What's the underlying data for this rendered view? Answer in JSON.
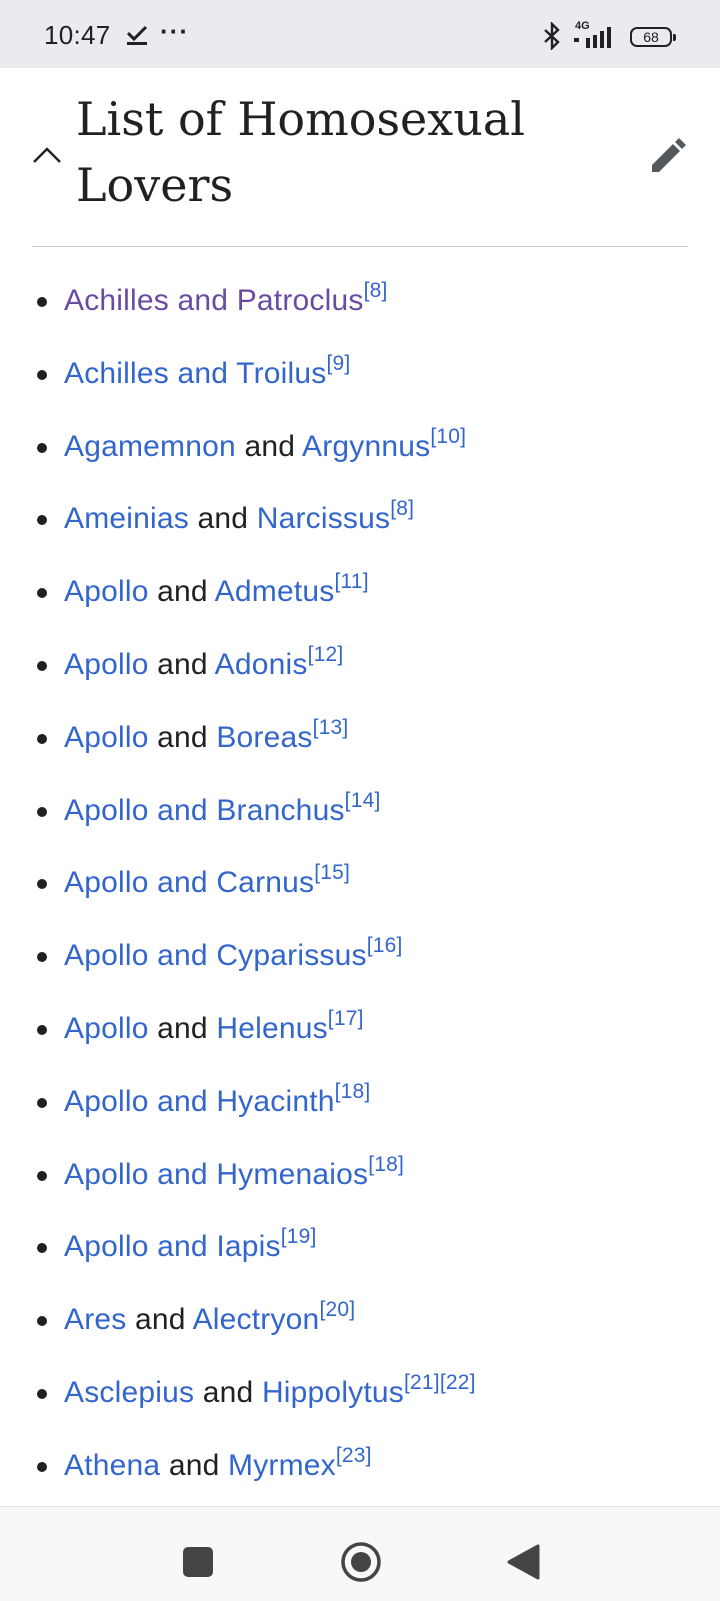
{
  "status_bar": {
    "time": "10:47",
    "network": "4G",
    "battery": "68",
    "icons": [
      "check-icon",
      "more-dots-icon",
      "bluetooth-icon",
      "signal-icon",
      "battery-icon"
    ]
  },
  "section": {
    "title": "List of Homosexual Lovers",
    "collapse_icon": "chevron-up-icon",
    "edit_icon": "pencil-icon"
  },
  "colors": {
    "link": "#3366cc",
    "visited_link": "#6b4ba1",
    "text": "#202122"
  },
  "items": [
    {
      "parts": [
        {
          "text": "Achilles and Patroclus",
          "link": true,
          "visited": true
        }
      ],
      "refs": "[8]"
    },
    {
      "parts": [
        {
          "text": "Achilles and Troilus",
          "link": true
        }
      ],
      "refs": "[9]"
    },
    {
      "parts": [
        {
          "text": "Agamemnon",
          "link": true
        },
        {
          "text": " and ",
          "link": false
        },
        {
          "text": "Argynnus",
          "link": true
        }
      ],
      "refs": "[10]"
    },
    {
      "parts": [
        {
          "text": "Ameinias",
          "link": true
        },
        {
          "text": " and ",
          "link": false
        },
        {
          "text": "Narcissus",
          "link": true
        }
      ],
      "refs": "[8]"
    },
    {
      "parts": [
        {
          "text": "Apollo",
          "link": true
        },
        {
          "text": " and ",
          "link": false
        },
        {
          "text": "Admetus",
          "link": true
        }
      ],
      "refs": "[11]"
    },
    {
      "parts": [
        {
          "text": "Apollo",
          "link": true
        },
        {
          "text": " and ",
          "link": false
        },
        {
          "text": "Adonis",
          "link": true
        }
      ],
      "refs": "[12]"
    },
    {
      "parts": [
        {
          "text": "Apollo",
          "link": true
        },
        {
          "text": " and ",
          "link": false
        },
        {
          "text": "Boreas",
          "link": true
        }
      ],
      "refs": "[13]"
    },
    {
      "parts": [
        {
          "text": "Apollo and Branchus",
          "link": true
        }
      ],
      "refs": "[14]"
    },
    {
      "parts": [
        {
          "text": "Apollo and Carnus",
          "link": true
        }
      ],
      "refs": "[15]"
    },
    {
      "parts": [
        {
          "text": "Apollo and Cyparissus",
          "link": true
        }
      ],
      "refs": "[16]"
    },
    {
      "parts": [
        {
          "text": "Apollo",
          "link": true
        },
        {
          "text": " and ",
          "link": false
        },
        {
          "text": "Helenus",
          "link": true
        }
      ],
      "refs": "[17]"
    },
    {
      "parts": [
        {
          "text": "Apollo and Hyacinth",
          "link": true
        }
      ],
      "refs": "[18]"
    },
    {
      "parts": [
        {
          "text": "Apollo and Hymenaios",
          "link": true
        }
      ],
      "refs": "[18]"
    },
    {
      "parts": [
        {
          "text": "Apollo and Iapis",
          "link": true
        }
      ],
      "refs": "[19]"
    },
    {
      "parts": [
        {
          "text": "Ares",
          "link": true
        },
        {
          "text": " and ",
          "link": false
        },
        {
          "text": "Alectryon",
          "link": true
        }
      ],
      "refs": "[20]"
    },
    {
      "parts": [
        {
          "text": "Asclepius",
          "link": true
        },
        {
          "text": " and ",
          "link": false
        },
        {
          "text": "Hippolytus",
          "link": true
        }
      ],
      "refs": "[21][22]"
    },
    {
      "parts": [
        {
          "text": "Athena",
          "link": true
        },
        {
          "text": " and ",
          "link": false
        },
        {
          "text": "Myrmex",
          "link": true
        }
      ],
      "refs": "[23]"
    }
  ],
  "nav_bar": {
    "icons": [
      "recents-square-icon",
      "home-circle-icon",
      "back-triangle-icon"
    ]
  }
}
